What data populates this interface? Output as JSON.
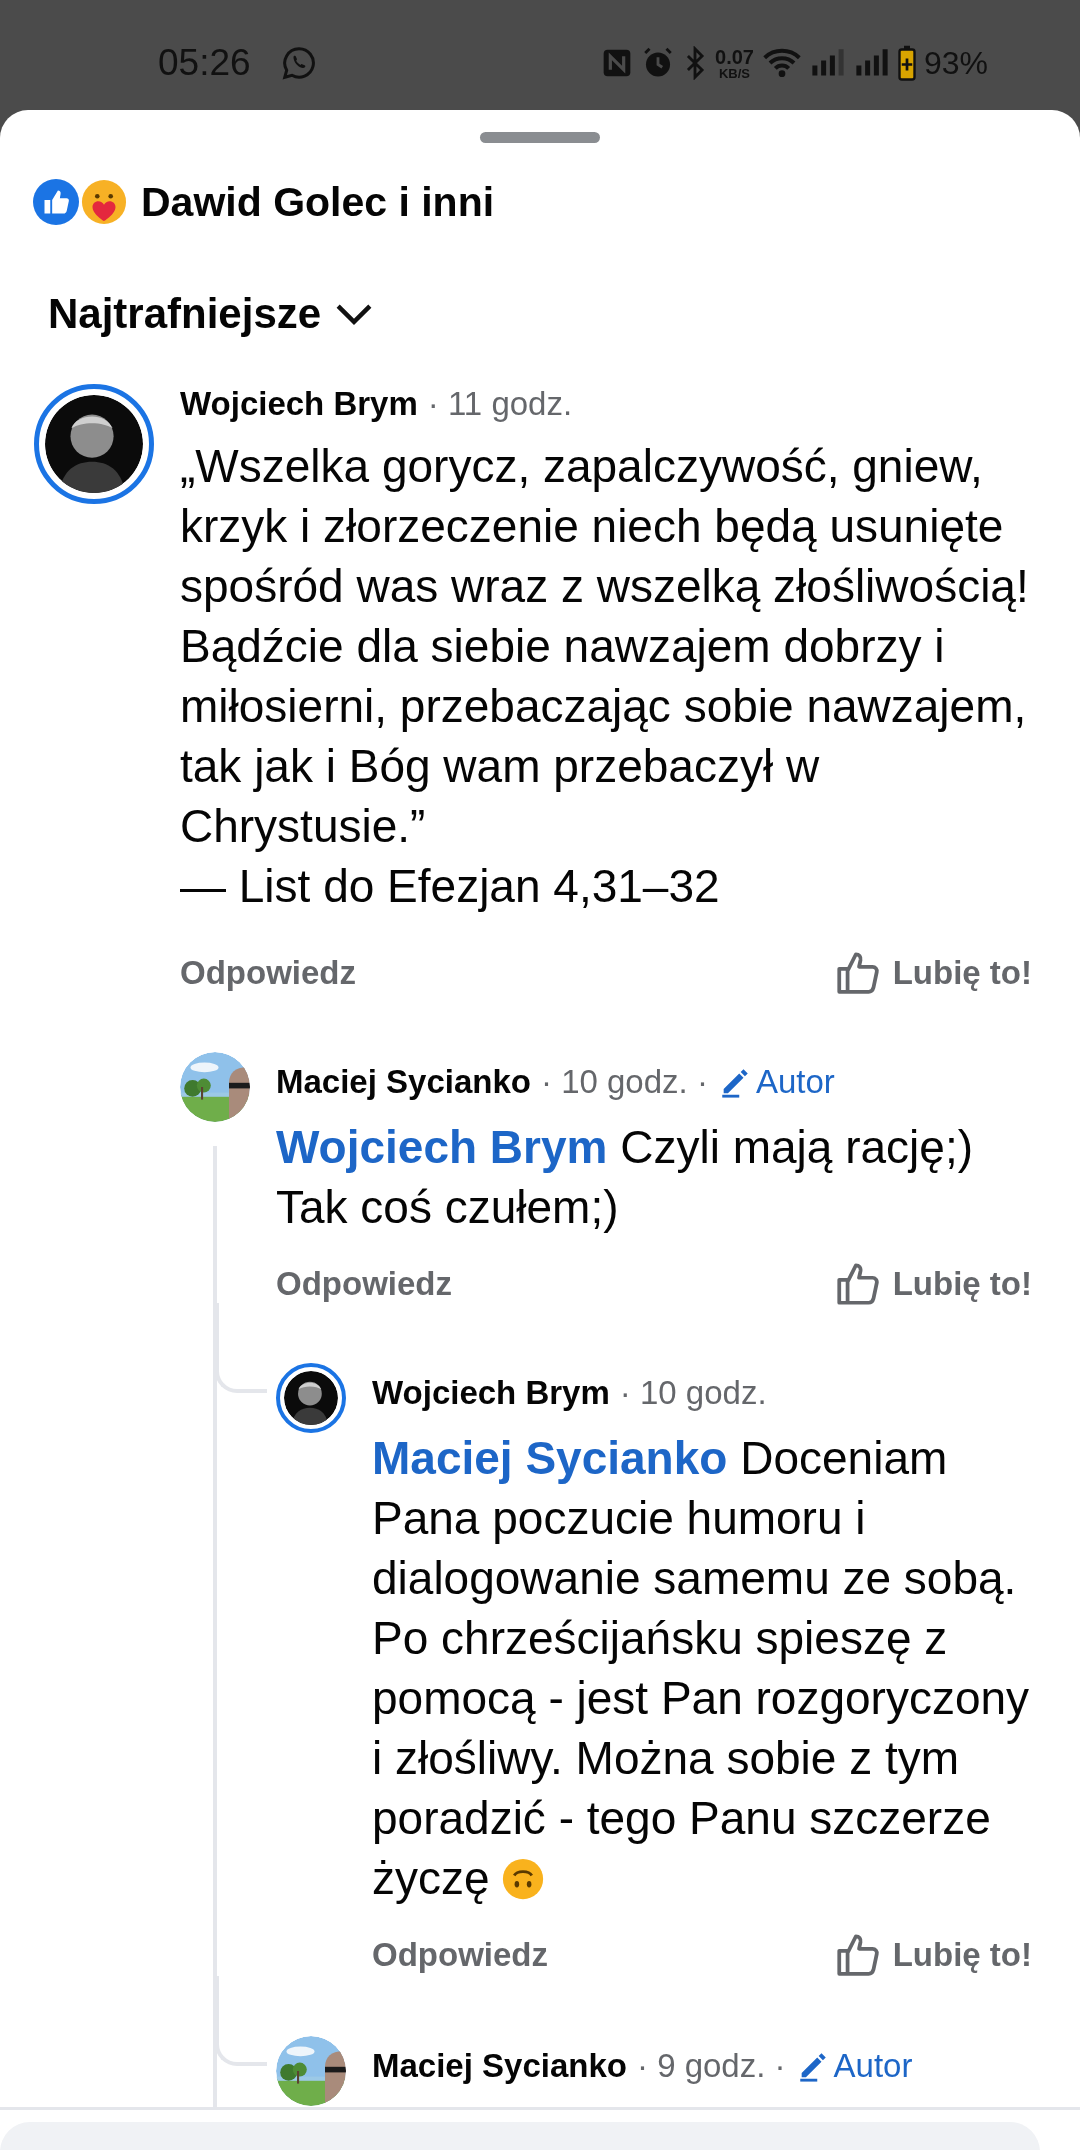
{
  "status_bar": {
    "time": "05:26",
    "speed": "0.07",
    "speed_unit": "KB/S",
    "battery": "93%"
  },
  "sheet": {
    "reactors": "Dawid Golec i inni",
    "sort": "Najtrafniejsze"
  },
  "comments": [
    {
      "author": "Wojciech Brym",
      "time": "· 11 godz.",
      "story_ring": true,
      "text": "„Wszelka gorycz, zapalczywość, gniew, krzyk i złorzeczenie niech będą usunięte spośród was wraz z wszelką złośliwością! Bądźcie dla siebie nawzajem dobrzy i miłosierni, przebaczając sobie nawzajem, tak jak i Bóg wam przebaczył w Chrystusie.”\n— List do Efezjan 4,31–32",
      "reply_label": "Odpowiedz",
      "like_label": "Lubię to!",
      "children": [
        {
          "author": "Maciej Sycianko",
          "time": "· 10 godz. ·",
          "badge": "Autor",
          "story_ring": false,
          "mention": "Wojciech Brym",
          "text": "Czyli mają rację;) Tak coś czułem;)",
          "reply_label": "Odpowiedz",
          "like_label": "Lubię to!",
          "children": [
            {
              "author": "Wojciech Brym",
              "time": "· 10 godz.",
              "story_ring": true,
              "mention": "Maciej Sycianko",
              "text": "Doceniam Pana poczucie humoru i dialogowanie samemu ze sobą. Po chrześcijańsku spieszę z pomocą - jest Pan rozgoryczony i złośliwy. Można sobie z tym poradzić - tego Panu szczerze życzę",
              "ends_with_emoji": true,
              "reply_label": "Odpowiedz",
              "like_label": "Lubię to!"
            },
            {
              "author": "Maciej Sycianko",
              "time": "· 9 godz. ·",
              "badge": "Autor",
              "story_ring": false
            }
          ]
        }
      ]
    }
  ]
}
